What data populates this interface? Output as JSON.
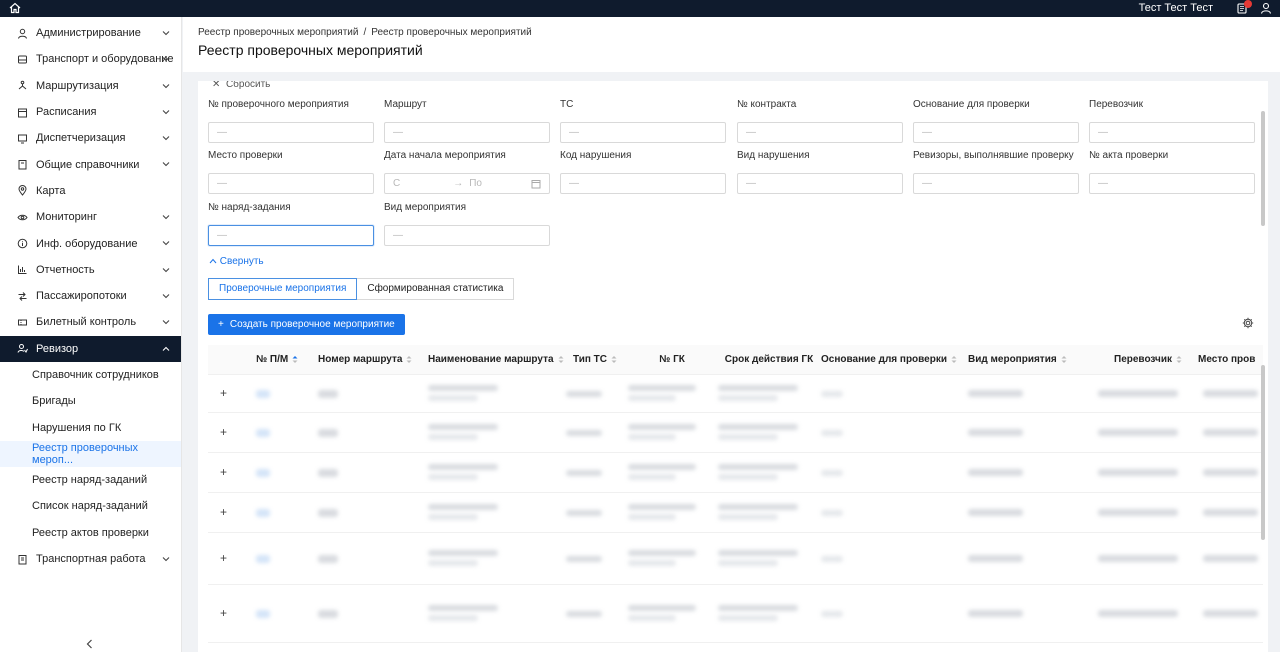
{
  "topbar": {
    "user_name": "Тест Тест Тест"
  },
  "sidebar": {
    "items": [
      {
        "label": "Администрирование",
        "icon": "user-icon",
        "expandable": true
      },
      {
        "label": "Транспорт и оборудование",
        "icon": "bus-icon",
        "expandable": true
      },
      {
        "label": "Маршрутизация",
        "icon": "route-icon",
        "expandable": true
      },
      {
        "label": "Расписания",
        "icon": "calendar-icon",
        "expandable": true
      },
      {
        "label": "Диспетчеризация",
        "icon": "monitor-icon",
        "expandable": true
      },
      {
        "label": "Общие справочники",
        "icon": "book-icon",
        "expandable": true
      },
      {
        "label": "Карта",
        "icon": "map-pin-icon",
        "expandable": false
      },
      {
        "label": "Мониторинг",
        "icon": "eye-icon",
        "expandable": true
      },
      {
        "label": "Инф. оборудование",
        "icon": "info-icon",
        "expandable": true
      },
      {
        "label": "Отчетность",
        "icon": "bar-chart-icon",
        "expandable": true
      },
      {
        "label": "Пассажиропотоки",
        "icon": "flow-icon",
        "expandable": true
      },
      {
        "label": "Билетный контроль",
        "icon": "ticket-icon",
        "expandable": true
      },
      {
        "label": "Ревизор",
        "icon": "inspector-icon",
        "expandable": true,
        "active": true
      }
    ],
    "sub_items": [
      "Справочник сотрудников",
      "Бригады",
      "Нарушения по ГК",
      "Реестр проверочных мероп...",
      "Реестр наряд-заданий",
      "Список наряд-заданий",
      "Реестр актов проверки"
    ],
    "current_sub": 3,
    "last_item": {
      "label": "Транспортная работа",
      "icon": "document-icon"
    }
  },
  "header": {
    "breadcrumb": [
      "Реестр проверочных мероприятий",
      "Реестр проверочных мероприятий"
    ],
    "title": "Реестр проверочных мероприятий"
  },
  "filters": {
    "reset_label": "Сбросить",
    "placeholder": "—",
    "fields": [
      "№ проверочного мероприятия",
      "Маршрут",
      "ТС",
      "№ контракта",
      "Основание для проверки",
      "Перевозчик",
      "Место проверки",
      "Дата начала мероприятия",
      "Код нарушения",
      "Вид нарушения",
      "Ревизоры, выполнявшие проверку",
      "№ акта проверки",
      "№ наряд-задания",
      "Вид мероприятия"
    ],
    "date_from": "С",
    "date_to": "По",
    "collapse_label": "Свернуть"
  },
  "tabs": [
    "Проверочные мероприятия",
    "Сформированная статистика"
  ],
  "active_tab": 0,
  "create_button": "Создать проверочное мероприятие",
  "table": {
    "columns": [
      "№ П/М",
      "Номер маршрута",
      "Наименование маршрута",
      "Тип ТС",
      "№ ГК",
      "Срок действия ГК",
      "Основание для проверки",
      "Вид мероприятия",
      "Перевозчик",
      "Место пров"
    ]
  }
}
